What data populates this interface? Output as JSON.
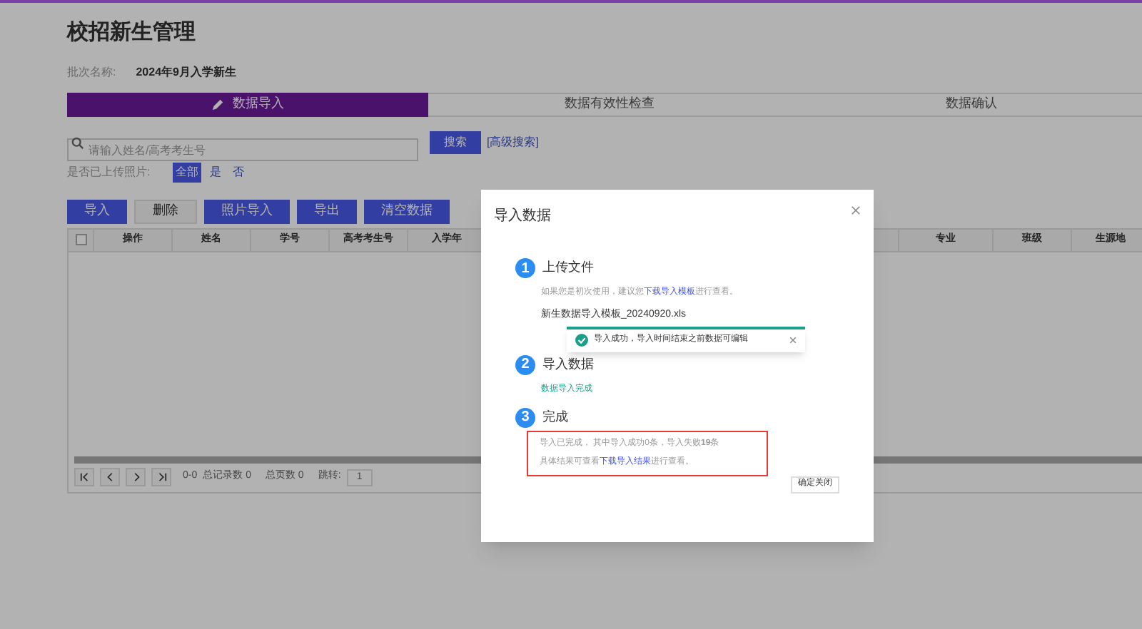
{
  "page_title": "校招新生管理",
  "batch": {
    "label": "批次名称:",
    "value": "2024年9月入学新生"
  },
  "steps": [
    {
      "label": "数据导入",
      "selected": true
    },
    {
      "label": "数据有效性检查",
      "selected": false
    },
    {
      "label": "数据确认",
      "selected": false
    }
  ],
  "search": {
    "placeholder": "请输入姓名/高考考生号",
    "button": "搜索",
    "advanced": "[高级搜索]"
  },
  "photo_filter": {
    "label": "是否已上传照片:",
    "options": [
      {
        "label": "全部",
        "selected": true
      },
      {
        "label": "是",
        "selected": false
      },
      {
        "label": "否",
        "selected": false
      }
    ]
  },
  "toolbar": [
    {
      "label": "导入",
      "kind": "primary"
    },
    {
      "label": "删除",
      "kind": "plain"
    },
    {
      "label": "照片导入",
      "kind": "primary"
    },
    {
      "label": "导出",
      "kind": "primary"
    },
    {
      "label": "清空数据",
      "kind": "primary"
    }
  ],
  "table": {
    "select_all": {
      "checked": false
    },
    "columns_left": [
      "操作",
      "姓名",
      "学号",
      "高考考生号",
      "入学年"
    ],
    "columns_right": [
      "专业",
      "班级",
      "生源地"
    ]
  },
  "pagination": {
    "range": "0-0",
    "total_label": "总记录数 0",
    "pages_label": "总页数 0",
    "jump_label": "跳转:",
    "jump_value": "1"
  },
  "dialog": {
    "title": "导入数据",
    "steps": [
      {
        "number": "1",
        "title": "上传文件"
      },
      {
        "number": "2",
        "title": "导入数据"
      },
      {
        "number": "3",
        "title": "完成"
      }
    ],
    "hint": {
      "before": "如果您是初次使用，建议您",
      "link": "下载导入模板",
      "after": "进行查看。"
    },
    "file_name": "新生数据导入模板_20240920.xls",
    "import_status": "数据导入完成",
    "result_line": "导入已完成， 其中导入成功0条，导入失败**19**条",
    "result_link": {
      "before": "具体结果可查看",
      "link": "下载导入结果",
      "after": "进行查看。"
    },
    "close_button": "确定关闭"
  },
  "toast": {
    "message": "导入成功，导入时间结束之前数据可编辑"
  }
}
